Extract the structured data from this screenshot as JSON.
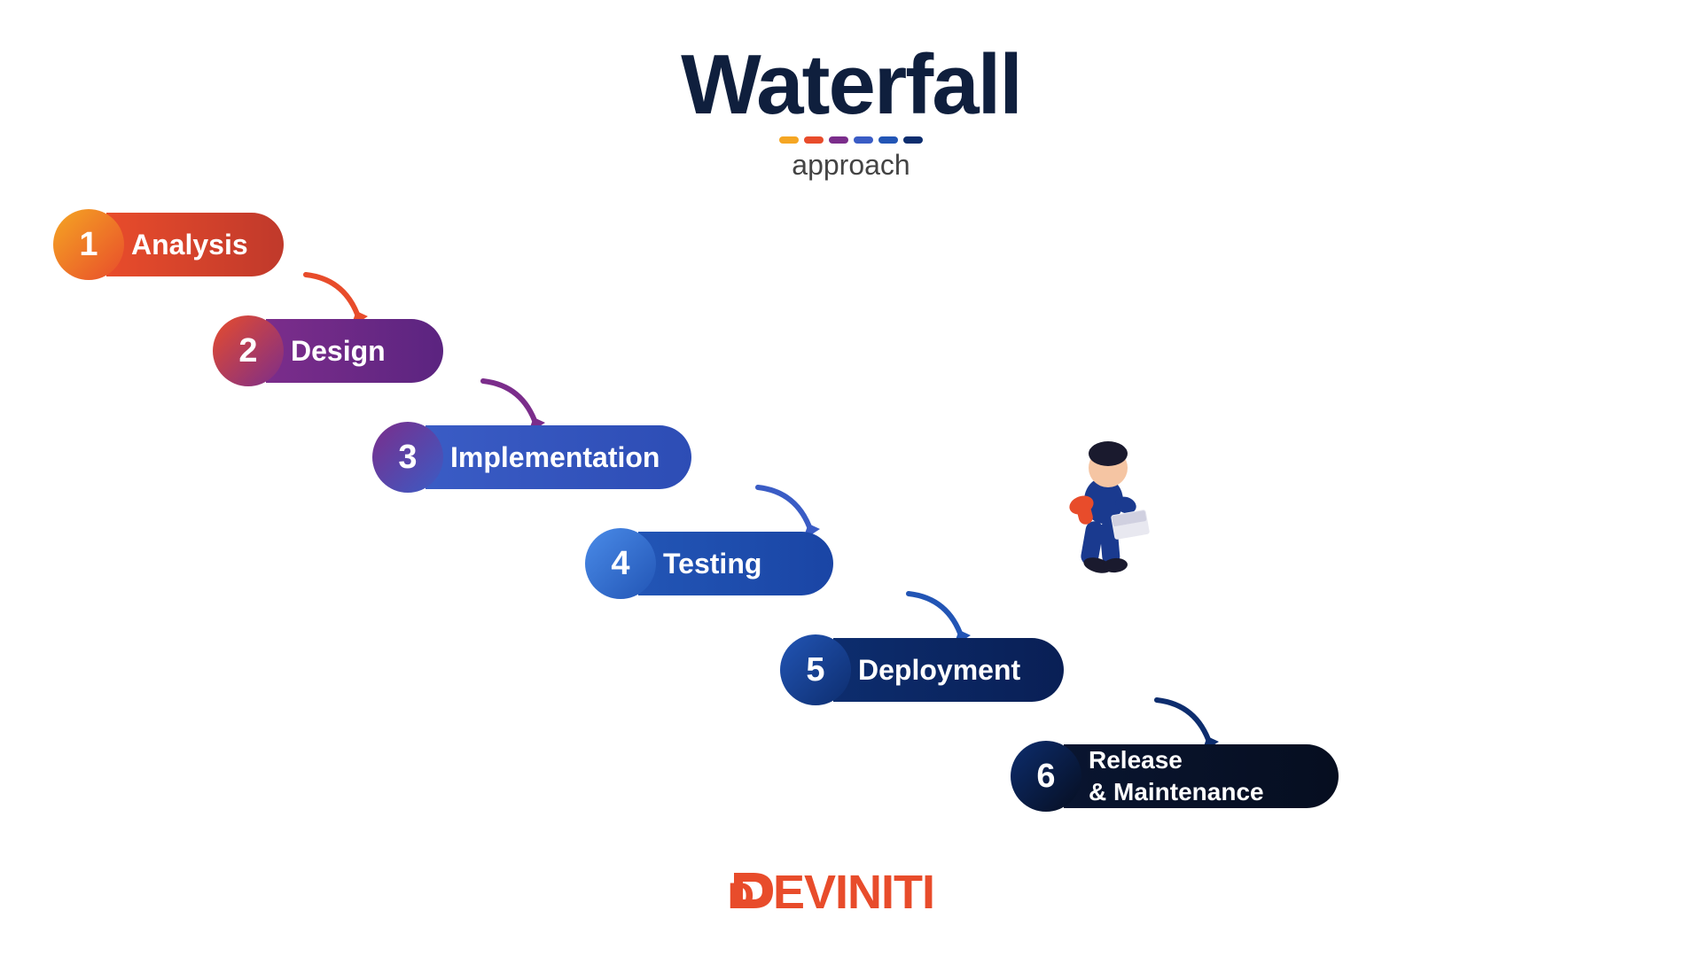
{
  "title": {
    "line1": "Waterfall",
    "line2": "approach"
  },
  "decoration": {
    "dots": [
      {
        "color": "#f5a623"
      },
      {
        "color": "#e84c2b"
      },
      {
        "color": "#7b2d8b"
      },
      {
        "color": "#3a5cc5"
      },
      {
        "color": "#2255b5"
      },
      {
        "color": "#0d2d6e"
      }
    ]
  },
  "steps": [
    {
      "number": "1",
      "label": "Analysis"
    },
    {
      "number": "2",
      "label": "Design"
    },
    {
      "number": "3",
      "label": "Implementation"
    },
    {
      "number": "4",
      "label": "Testing"
    },
    {
      "number": "5",
      "label": "Deployment"
    },
    {
      "number": "6",
      "label": "Release\n& Maintenance"
    }
  ],
  "logo": {
    "text": "DEVINITI",
    "display": "ᴅeviniti"
  }
}
